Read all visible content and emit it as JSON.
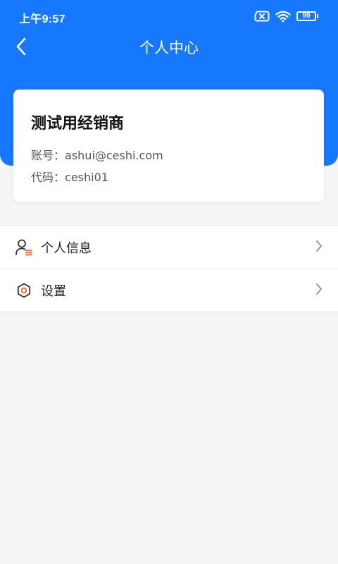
{
  "status_bar": {
    "time": "上午9:57",
    "battery": "99",
    "icons": [
      "sim-no-signal-icon",
      "wifi-icon",
      "battery-icon"
    ]
  },
  "nav": {
    "title": "个人中心",
    "back_icon": "chevron-left-icon"
  },
  "profile": {
    "name": "测试用经销商",
    "account_label": "账号：",
    "account_value": "ashui@ceshi.com",
    "code_label": "代码：",
    "code_value": "ceshi01"
  },
  "menu": {
    "items": [
      {
        "label": "个人信息",
        "icon": "user-info-icon"
      },
      {
        "label": "设置",
        "icon": "settings-icon"
      }
    ]
  },
  "colors": {
    "brand": "#1677ff",
    "background": "#f5f5f5",
    "icon_accent": "#f26522"
  }
}
